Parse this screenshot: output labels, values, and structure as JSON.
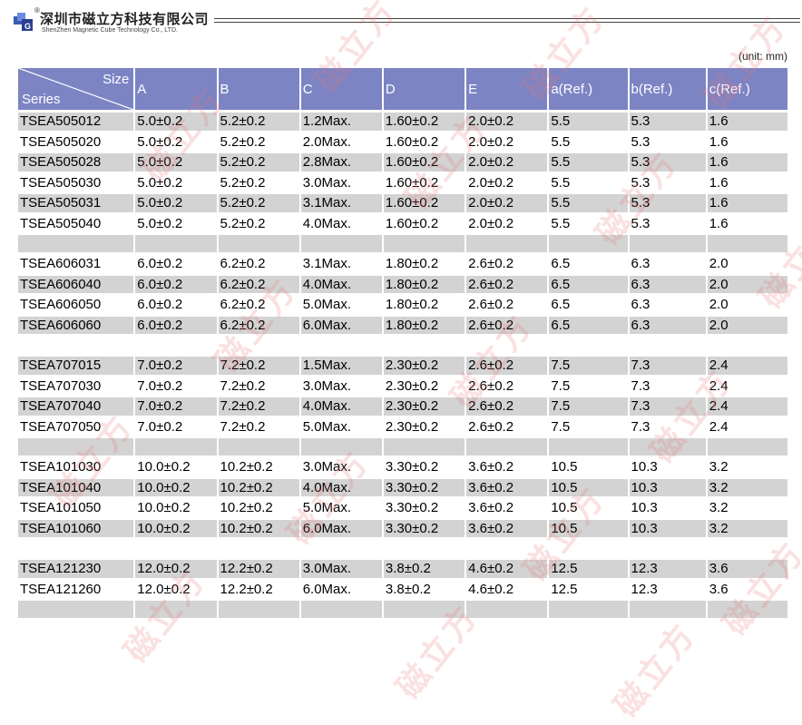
{
  "header": {
    "company_cn": "深圳市磁立方科技有限公司",
    "company_en": "ShenZhen Magnetic Cube Technology Co., LTD.",
    "registered_mark": "®"
  },
  "watermark_text": "磁立方",
  "unit_note": "(unit: mm)",
  "table": {
    "corner_top": "Size",
    "corner_bottom": "Series",
    "columns": [
      "A",
      "B",
      "C",
      "D",
      "E",
      "a(Ref.)",
      "b(Ref.)",
      "c(Ref.)"
    ],
    "rows": [
      [
        "TSEA505012",
        "5.0±0.2",
        "5.2±0.2",
        "1.2Max.",
        "1.60±0.2",
        "2.0±0.2",
        "5.5",
        "5.3",
        "1.6"
      ],
      [
        "TSEA505020",
        "5.0±0.2",
        "5.2±0.2",
        "2.0Max.",
        "1.60±0.2",
        "2.0±0.2",
        "5.5",
        "5.3",
        "1.6"
      ],
      [
        "TSEA505028",
        "5.0±0.2",
        "5.2±0.2",
        "2.8Max.",
        "1.60±0.2",
        "2.0±0.2",
        "5.5",
        "5.3",
        "1.6"
      ],
      [
        "TSEA505030",
        "5.0±0.2",
        "5.2±0.2",
        "3.0Max.",
        "1.60±0.2",
        "2.0±0.2",
        "5.5",
        "5.3",
        "1.6"
      ],
      [
        "TSEA505031",
        "5.0±0.2",
        "5.2±0.2",
        "3.1Max.",
        "1.60±0.2",
        "2.0±0.2",
        "5.5",
        "5.3",
        "1.6"
      ],
      [
        "TSEA505040",
        "5.0±0.2",
        "5.2±0.2",
        "4.0Max.",
        "1.60±0.2",
        "2.0±0.2",
        "5.5",
        "5.3",
        "1.6"
      ],
      [],
      [
        "TSEA606031",
        "6.0±0.2",
        "6.2±0.2",
        "3.1Max.",
        "1.80±0.2",
        "2.6±0.2",
        "6.5",
        "6.3",
        "2.0"
      ],
      [
        "TSEA606040",
        "6.0±0.2",
        "6.2±0.2",
        "4.0Max.",
        "1.80±0.2",
        "2.6±0.2",
        "6.5",
        "6.3",
        "2.0"
      ],
      [
        "TSEA606050",
        "6.0±0.2",
        "6.2±0.2",
        "5.0Max.",
        "1.80±0.2",
        "2.6±0.2",
        "6.5",
        "6.3",
        "2.0"
      ],
      [
        "TSEA606060",
        "6.0±0.2",
        "6.2±0.2",
        "6.0Max.",
        "1.80±0.2",
        "2.6±0.2",
        "6.5",
        "6.3",
        "2.0"
      ],
      [],
      [
        "TSEA707015",
        "7.0±0.2",
        "7.2±0.2",
        "1.5Max.",
        "2.30±0.2",
        "2.6±0.2",
        "7.5",
        "7.3",
        "2.4"
      ],
      [
        "TSEA707030",
        "7.0±0.2",
        "7.2±0.2",
        "3.0Max.",
        "2.30±0.2",
        "2.6±0.2",
        "7.5",
        "7.3",
        "2.4"
      ],
      [
        "TSEA707040",
        "7.0±0.2",
        "7.2±0.2",
        "4.0Max.",
        "2.30±0.2",
        "2.6±0.2",
        "7.5",
        "7.3",
        "2.4"
      ],
      [
        "TSEA707050",
        "7.0±0.2",
        "7.2±0.2",
        "5.0Max.",
        "2.30±0.2",
        "2.6±0.2",
        "7.5",
        "7.3",
        "2.4"
      ],
      [],
      [
        "TSEA101030",
        "10.0±0.2",
        "10.2±0.2",
        "3.0Max.",
        "3.30±0.2",
        "3.6±0.2",
        "10.5",
        "10.3",
        "3.2"
      ],
      [
        "TSEA101040",
        "10.0±0.2",
        "10.2±0.2",
        "4.0Max.",
        "3.30±0.2",
        "3.6±0.2",
        "10.5",
        "10.3",
        "3.2"
      ],
      [
        "TSEA101050",
        "10.0±0.2",
        "10.2±0.2",
        "5.0Max.",
        "3.30±0.2",
        "3.6±0.2",
        "10.5",
        "10.3",
        "3.2"
      ],
      [
        "TSEA101060",
        "10.0±0.2",
        "10.2±0.2",
        "6.0Max.",
        "3.30±0.2",
        "3.6±0.2",
        "10.5",
        "10.3",
        "3.2"
      ],
      [],
      [
        "TSEA121230",
        "12.0±0.2",
        "12.2±0.2",
        "3.0Max.",
        "3.8±0.2",
        "4.6±0.2",
        "12.5",
        "12.3",
        "3.6"
      ],
      [
        "TSEA121260",
        "12.0±0.2",
        "12.2±0.2",
        "6.0Max.",
        "3.8±0.2",
        "4.6±0.2",
        "12.5",
        "12.3",
        "3.6"
      ],
      []
    ]
  },
  "colors": {
    "header_bg": "#7c84c4",
    "stripe_bg": "#d3d3d3",
    "logo_blue": "#3b5bb5",
    "watermark": "#e87878"
  }
}
